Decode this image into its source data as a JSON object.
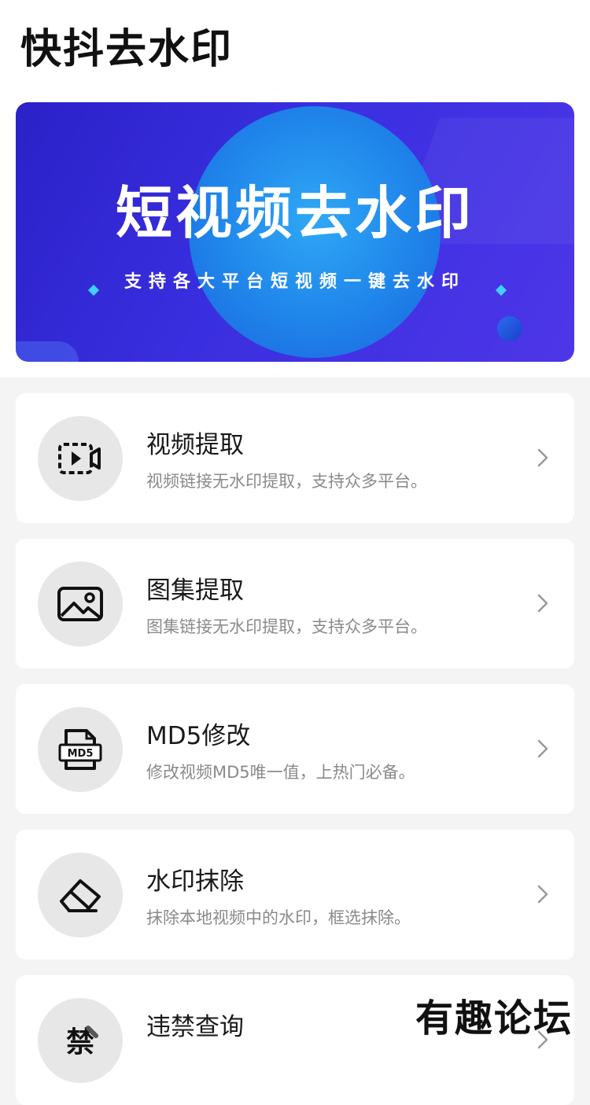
{
  "app": {
    "title": "快抖去水印"
  },
  "banner": {
    "title": "短视频去水印",
    "subtitle": "支持各大平台短视频一键去水印"
  },
  "features": [
    {
      "title": "视频提取",
      "desc": "视频链接无水印提取，支持众多平台。",
      "icon": "video-icon"
    },
    {
      "title": "图集提取",
      "desc": "图集链接无水印提取，支持众多平台。",
      "icon": "image-icon"
    },
    {
      "title": "MD5修改",
      "desc": "修改视频MD5唯一值，上热门必备。",
      "icon": "md5-file-icon",
      "icon_label": "MD5"
    },
    {
      "title": "水印抹除",
      "desc": "抹除本地视频中的水印，框选抹除。",
      "icon": "eraser-icon"
    },
    {
      "title": "违禁查询",
      "desc": "",
      "icon": "forbidden-word-icon",
      "icon_label": "禁"
    }
  ],
  "watermark": "有趣论坛",
  "colors": {
    "banner_start": "#2b21c8",
    "banner_circle": "#1f84ea",
    "card_bg": "#ffffff",
    "icon_bg": "#e7e7e7",
    "page_bg": "#f4f4f4"
  }
}
